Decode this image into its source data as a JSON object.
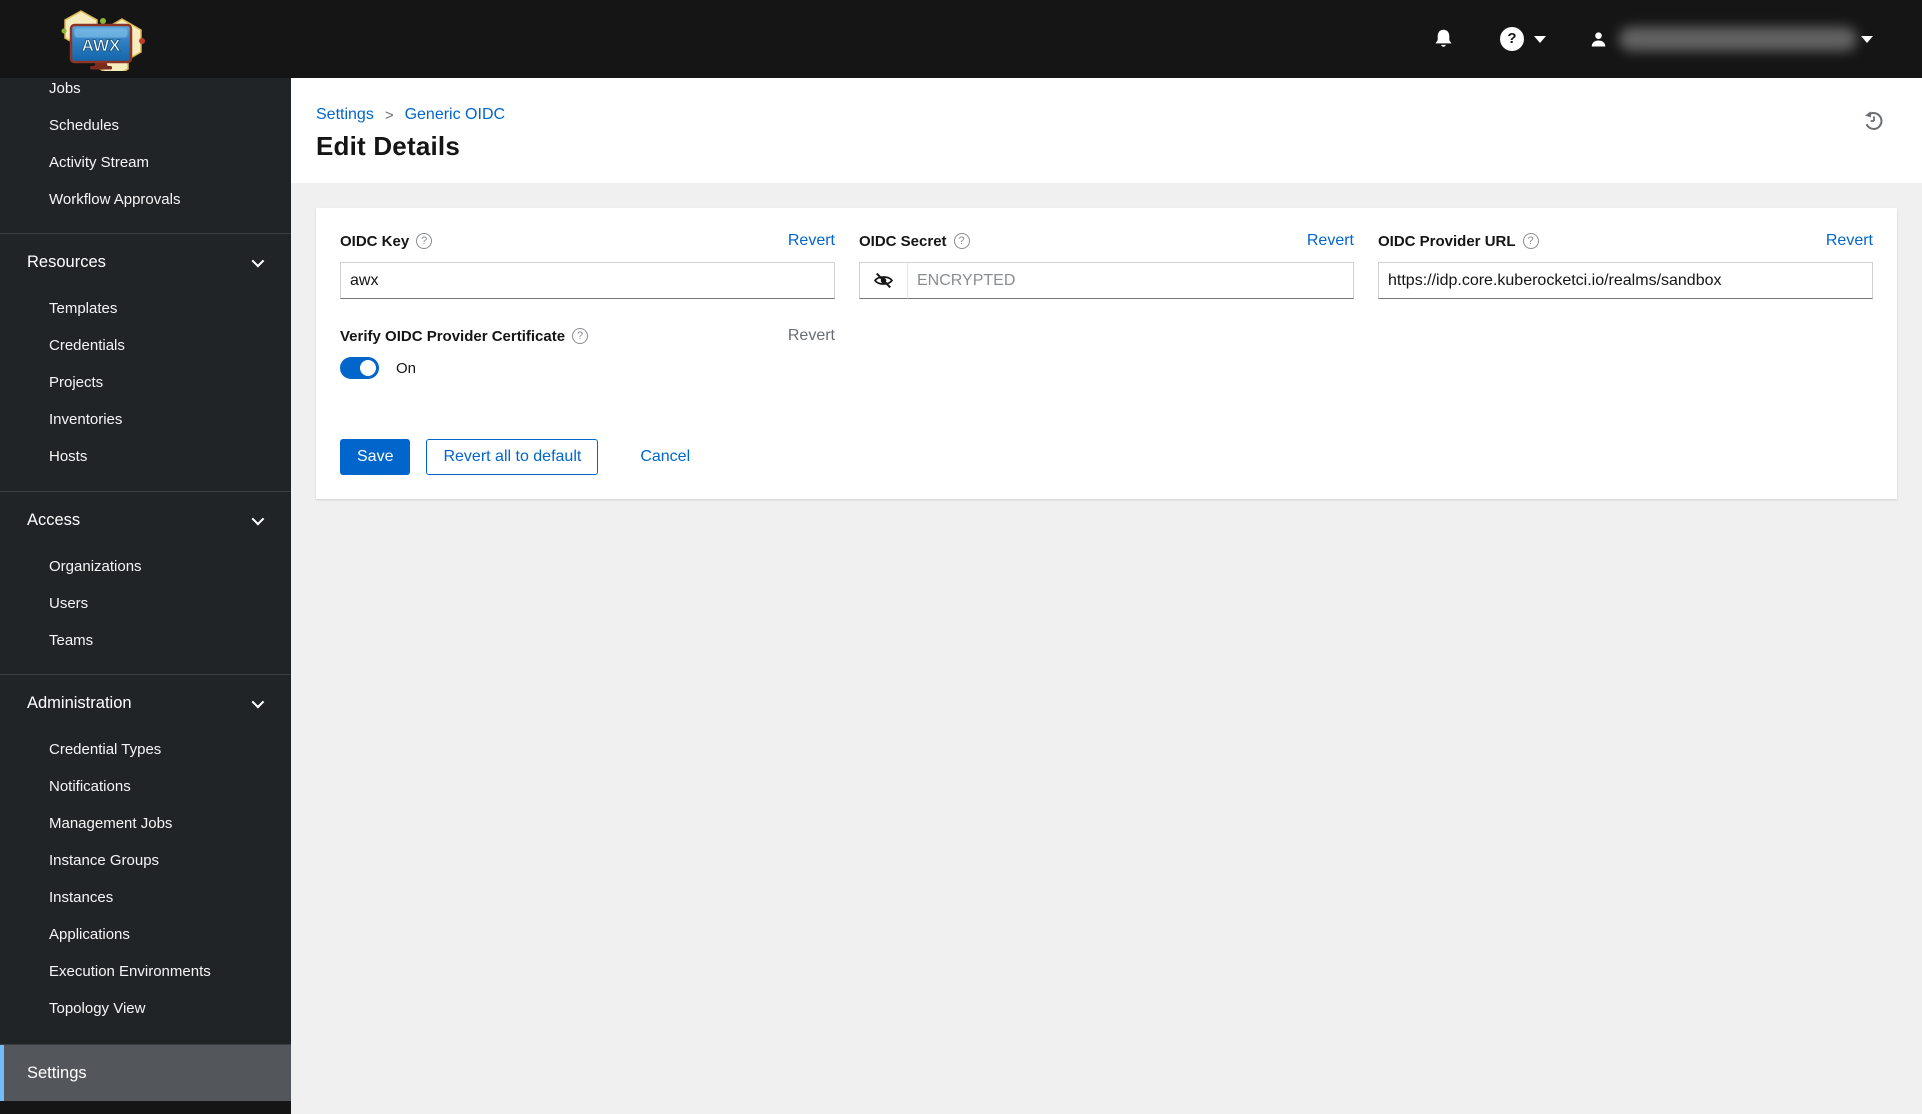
{
  "colors": {
    "accent": "#0066cc",
    "masthead_bg": "#151515",
    "sidebar_bg": "#212427",
    "sidebar_selected_bg": "#53565a",
    "sidebar_selected_accent": "#73bcf7",
    "page_bg": "#f0f0f0",
    "muted_text": "#6a6e73"
  },
  "masthead": {
    "logo_text": "AWX",
    "icons": [
      "menu-icon",
      "bell-icon",
      "help-icon",
      "caret-down-icon",
      "user-icon"
    ],
    "username_redacted": true
  },
  "sidebar": {
    "top_items": [
      "Jobs",
      "Schedules",
      "Activity Stream",
      "Workflow Approvals"
    ],
    "groups": [
      {
        "label": "Resources",
        "items": [
          "Templates",
          "Credentials",
          "Projects",
          "Inventories",
          "Hosts"
        ]
      },
      {
        "label": "Access",
        "items": [
          "Organizations",
          "Users",
          "Teams"
        ]
      },
      {
        "label": "Administration",
        "items": [
          "Credential Types",
          "Notifications",
          "Management Jobs",
          "Instance Groups",
          "Instances",
          "Applications",
          "Execution Environments",
          "Topology View"
        ]
      }
    ],
    "selected_item": "Settings"
  },
  "breadcrumb": {
    "items": [
      "Settings",
      "Generic OIDC"
    ],
    "separator": ">"
  },
  "page": {
    "title": "Edit Details"
  },
  "form": {
    "fields": [
      {
        "label": "OIDC Key",
        "revert_label": "Revert",
        "value": "awx"
      },
      {
        "label": "OIDC Secret",
        "revert_label": "Revert",
        "placeholder": "ENCRYPTED"
      },
      {
        "label": "OIDC Provider URL",
        "revert_label": "Revert",
        "value": "https://idp.core.kuberocketci.io/realms/sandbox"
      },
      {
        "label": "Verify OIDC Provider Certificate",
        "revert_label": "Revert",
        "state_label": "On"
      }
    ],
    "actions": {
      "save": "Save",
      "revert_all": "Revert all to default",
      "cancel": "Cancel"
    }
  }
}
